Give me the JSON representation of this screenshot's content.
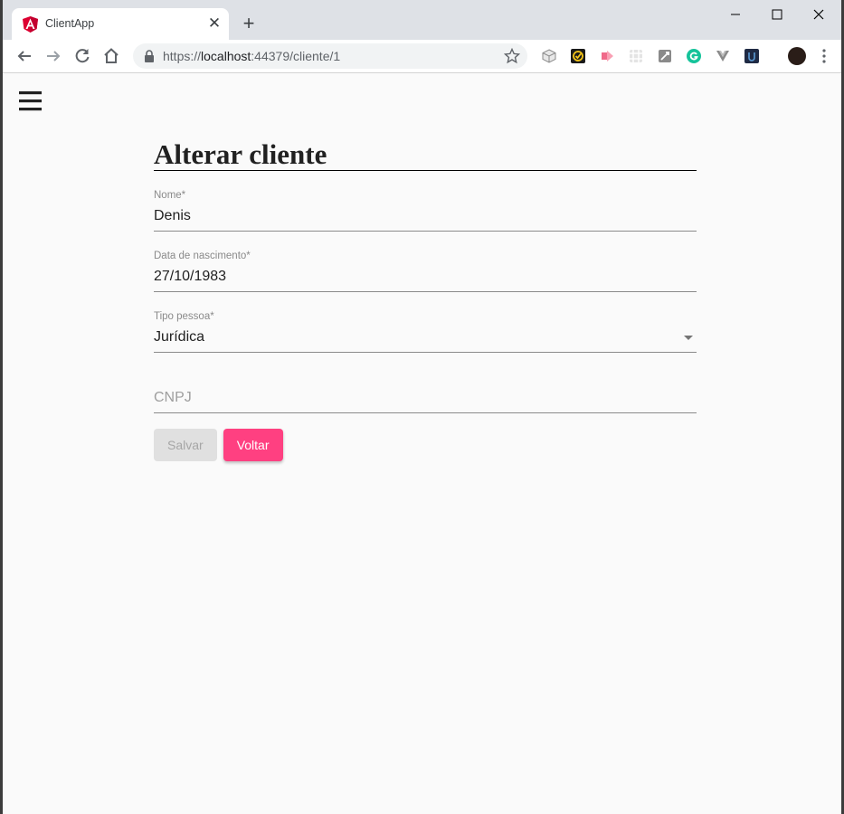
{
  "browser": {
    "tab_title": "ClientApp",
    "url_scheme": "https://",
    "url_host": "localhost",
    "url_rest": ":44379/cliente/1",
    "accent": "#ff4081"
  },
  "page": {
    "title": "Alterar cliente",
    "fields": [
      {
        "label": "Nome*",
        "value": "Denis"
      },
      {
        "label": "Data de nascimento*",
        "value": "27/10/1983"
      },
      {
        "label": "Tipo pessoa*",
        "value": "Jurídica"
      },
      {
        "label": "",
        "value": "",
        "placeholder": "CNPJ"
      }
    ],
    "buttons": {
      "save": "Salvar",
      "back": "Voltar"
    }
  }
}
